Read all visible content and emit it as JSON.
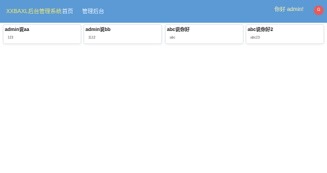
{
  "navbar": {
    "brand": "XXBAXL后台管理系统",
    "links": [
      "首页",
      "管理后台"
    ],
    "greeting": "你好 admin!",
    "avatar_text": "G"
  },
  "cards": [
    {
      "title": "admin说aa",
      "body": "123"
    },
    {
      "title": "admin说bb",
      "body": "1112"
    },
    {
      "title": "abc说你好",
      "body": "abc"
    },
    {
      "title": "abc说你好2",
      "body": "abc23"
    }
  ],
  "colors": {
    "navbar_bg": "#5b9ad5",
    "brand_text": "#f5e96e",
    "avatar_bg": "#e85a5a"
  }
}
